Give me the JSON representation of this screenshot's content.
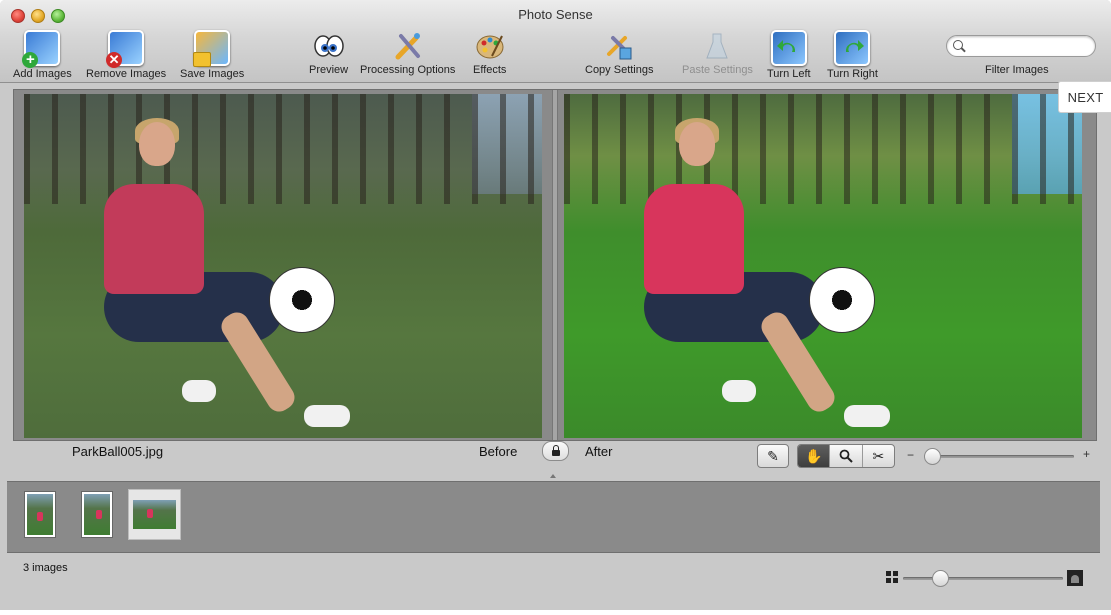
{
  "window": {
    "title": "Photo Sense"
  },
  "toolbar": {
    "add_images": "Add Images",
    "remove_images": "Remove Images",
    "save_images": "Save Images",
    "preview": "Preview",
    "processing_options": "Processing Options",
    "effects": "Effects",
    "copy_settings": "Copy Settings",
    "paste_settings": "Paste Settings",
    "turn_left": "Turn Left",
    "turn_right": "Turn Right",
    "filter_images": "Filter Images",
    "search_value": ""
  },
  "next_button": "NEXT",
  "preview": {
    "filename": "ParkBall005.jpg",
    "before_label": "Before",
    "after_label": "After"
  },
  "viewer_zoom_level": 0.0,
  "thumbnails": {
    "count": 3,
    "selected_index": 2
  },
  "status": {
    "image_count": "3 images"
  },
  "thumbnail_size_level": 0.2,
  "icons": {
    "add": "add-image-icon",
    "remove": "remove-image-icon",
    "save": "save-image-icon",
    "preview": "eyes-icon",
    "processing": "magic-wand-icon",
    "effects": "palette-icon",
    "copy": "copy-settings-icon",
    "paste": "paste-settings-icon",
    "turn_left": "rotate-left-icon",
    "turn_right": "rotate-right-icon",
    "lock": "lock-icon",
    "pencil": "pencil-icon",
    "hand": "hand-icon",
    "zoom": "magnifier-icon",
    "crop": "scissors-icon"
  }
}
